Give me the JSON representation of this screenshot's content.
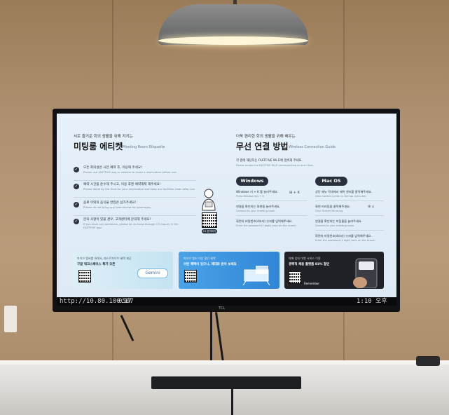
{
  "screen": {
    "left_heading": {
      "kicker": "서로 즐거운 회의 생활을 위해 지키는",
      "title": "미팅룸 에티켓",
      "subtitle": "Meeting Room Etiquette"
    },
    "etiquette_items": [
      {
        "ko": "모든 회의실은 사전 예약 후, 이용해 주세요!",
        "en": "Please use FASTFIVE app or website to make a reservation before use."
      },
      {
        "ko": "예약 시간을 준수해 주시고, 이용 후엔 예약해제 해주세요!",
        "en": "Please abide by the time for your reservation and keep our facilities clean after use."
      },
      {
        "ko": "음료 이외의 음식물 반입은 삼가주세요!",
        "en": "Please do not bring any food except for beverages."
      },
      {
        "ko": "문의 사항이 있을 경우, 고객센터에 문의해 주세요!",
        "en": "If you have any questions, please let us know through CS inquiry in the FASTFIVE app."
      }
    ],
    "qr_caption": "CS 문의하기",
    "right_heading": {
      "kicker": "더욱 편리한 회의 생활을 위해 배우는",
      "title": "무선 연결 방법",
      "subtitle": "Wireless Connection Guide"
    },
    "wifi_notice": {
      "ko": "각 층에 해당하는 FASTFIVE Wi-Fi에 접속해 주세요.",
      "en": "Please access the FASTFIVE Wi-Fi corresponding to each floor."
    },
    "windows": {
      "label": "Windows",
      "steps": [
        {
          "ko": "Windows 키 + K 를 눌러주세요.",
          "en": "Press Window key + K",
          "icon": "⊞ + K"
        },
        {
          "ko": "연결을 확인하는 화면을 눌러주세요.",
          "en": "Connect to your meeting room"
        },
        {
          "ko": "화면의 비밀번호(4자리) 숫자를 입력해주세요.",
          "en": "Enter the password (4 digit) seen on the screen"
        }
      ]
    },
    "mac": {
      "label": "Mac OS",
      "steps": [
        {
          "ko": "상단 메뉴 막대에서 제어 센터를 클릭해주세요.",
          "en": "Click Control Center in the top menu bar",
          "icon": "⊛ ▫"
        },
        {
          "ko": "화면 미러링을 클릭해주세요.",
          "en": "Click Screen Mirroring"
        },
        {
          "ko": "연결을 확인하는 미팅룸을 눌러주세요.",
          "en": "Connect to your meeting room"
        },
        {
          "ko": "화면의 비밀번호(4자리) 숫자를 입력해주세요.",
          "en": "Enter the password (4 digit) seen on the screen"
        }
      ]
    },
    "banners": [
      {
        "line1": "파이브 멤버를 위해서, 패스트파이브 혜택 제공",
        "line2": "구글 워크스페이스 특가 오픈",
        "tag": "Gemini"
      },
      {
        "line1": "파이브 멤버 대상 할인 혜택",
        "line2": "이런 혜택이 있으니, 제대로 받아 보세요"
      },
      {
        "line1": "매매·임대 대행 서비스 이용",
        "line2": "경력직 채용 플랫폼 83% 할인",
        "tag": "Remember"
      }
    ]
  },
  "taskbar": {
    "ip": "http://10.80.100.17",
    "code": "0507",
    "clock": "1:10 오후"
  },
  "tv_brand": "TCL"
}
